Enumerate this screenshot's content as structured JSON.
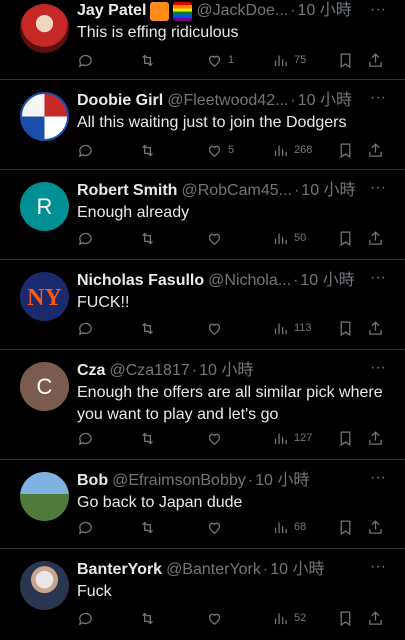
{
  "tweets": [
    {
      "name": "Jay Patel",
      "handle": "@JackDoe...",
      "time": "10 小時",
      "text": "This is effing ridiculous",
      "likes": "1",
      "views": "75",
      "avatar_color": "#7a1d1d",
      "avatar_letter": "",
      "avatar_type": "photo-red"
    },
    {
      "name": "Doobie Girl",
      "handle": "@Fleetwood42...",
      "time": "10 小時",
      "text": "All this waiting just to join the Dodgers",
      "likes": "5",
      "views": "268",
      "avatar_color": "#3a6fb0",
      "avatar_letter": "",
      "avatar_type": "badge"
    },
    {
      "name": "Robert Smith",
      "handle": "@RobCam45...",
      "time": "10 小時",
      "text": "Enough already",
      "likes": "",
      "views": "50",
      "avatar_color": "#008f92",
      "avatar_letter": "R",
      "avatar_type": "letter"
    },
    {
      "name": "Nicholas Fasullo",
      "handle": "@Nichola...",
      "time": "10 小時",
      "text": "FUCK!!",
      "likes": "",
      "views": "113",
      "avatar_color": "#1a2a6c",
      "avatar_letter": "",
      "avatar_type": "mets"
    },
    {
      "name": "Cza",
      "handle": "@Cza1817",
      "time": "10 小時",
      "text": "Enough the offers are all similar pick where you want to play and let's go",
      "likes": "",
      "views": "127",
      "avatar_color": "#7b5b4f",
      "avatar_letter": "C",
      "avatar_type": "letter"
    },
    {
      "name": "Bob",
      "handle": "@EfraimsonBobby",
      "time": "10 小時",
      "text": "Go back to Japan dude",
      "likes": "",
      "views": "68",
      "avatar_color": "#4f7a3b",
      "avatar_letter": "",
      "avatar_type": "photo-green"
    },
    {
      "name": "BanterYork",
      "handle": "@BanterYork",
      "time": "10 小時",
      "text": "Fuck",
      "likes": "",
      "views": "52",
      "avatar_color": "#3a4b6b",
      "avatar_letter": "",
      "avatar_type": "photo-blue"
    }
  ],
  "separator": "·",
  "more_label": "···",
  "accent": {
    "name": "#e7e9ea",
    "muted": "#71767b",
    "border": "#2f3336"
  }
}
